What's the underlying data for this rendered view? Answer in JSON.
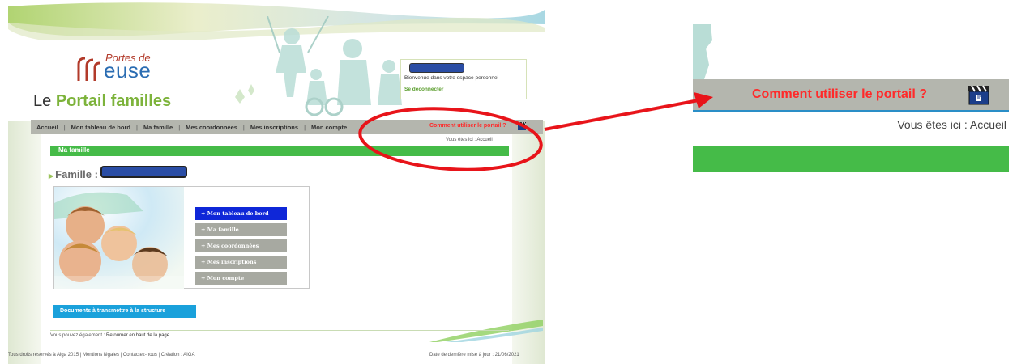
{
  "logo": {
    "small_text": "Portes de",
    "large_text": "euse"
  },
  "site_title": {
    "prefix": "Le ",
    "highlight": "Portail familles"
  },
  "user_box": {
    "welcome": "Bienvenue dans votre espace personnel",
    "logout": "Se déconnecter"
  },
  "nav": {
    "items": [
      "Accueil",
      "Mon tableau de bord",
      "Ma famille",
      "Mes coordonnées",
      "Mes inscriptions",
      "Mon compte"
    ],
    "separator": "|",
    "help": "Comment utiliser le portail ?"
  },
  "breadcrumb": "Vous êtes ici : Accueil",
  "section": {
    "title": "Ma famille"
  },
  "family": {
    "label": "Famille :"
  },
  "side_menu": [
    {
      "label": "+ Mon tableau de bord",
      "active": true
    },
    {
      "label": "+ Ma famille",
      "active": false
    },
    {
      "label": "+ Mes coordonnées",
      "active": false
    },
    {
      "label": "+ Mes inscriptions",
      "active": false
    },
    {
      "label": "+ Mon compte",
      "active": false
    }
  ],
  "documents_button": "Documents à transmettre à la structure",
  "bottom": {
    "prefix": "Vous pouvez également : ",
    "link": "Retourner en haut de la page"
  },
  "footer": {
    "left": "Tous droits réservés à Aiga 2015 | Mentions légales | Contactez-nous | Création : AIGA",
    "right": "Date de dernière mise à jour : 21/06/2021"
  },
  "zoom": {
    "help": "Comment utiliser le portail ?",
    "breadcrumb": "Vous êtes ici : Accueil"
  },
  "colors": {
    "nav_bg": "#b4b6ae",
    "green": "#45bb48",
    "help_red": "#ff2a2a",
    "active_blue": "#0f27d8",
    "inactive_grey": "#a7a9a1",
    "docs_blue": "#1aa1db",
    "annotation_red": "#e8141a",
    "redaction_blue": "#2a4da5"
  }
}
